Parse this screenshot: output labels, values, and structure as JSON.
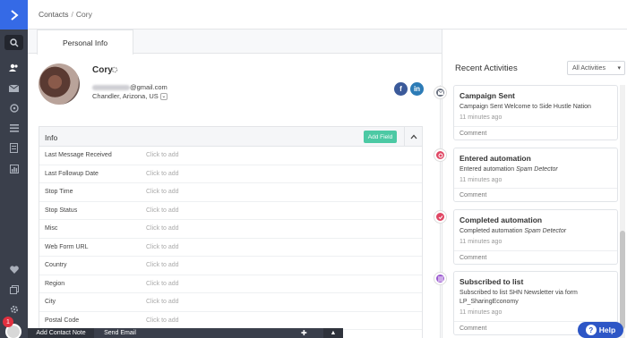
{
  "breadcrumb": {
    "root": "Contacts",
    "separator": "/",
    "current": "Cory"
  },
  "tabs": [
    {
      "label": "Personal Info"
    }
  ],
  "contact": {
    "name": "Cory",
    "email_suffix": "@gmail.com",
    "location": "Chandler, Arizona, US"
  },
  "info": {
    "title": "Info",
    "add_field_label": "Add Field",
    "placeholder": "Click to add",
    "fields": [
      {
        "label": "Last Message Received"
      },
      {
        "label": "Last Followup Date"
      },
      {
        "label": "Stop Time"
      },
      {
        "label": "Stop Status"
      },
      {
        "label": "Misc"
      },
      {
        "label": "Web Form URL"
      },
      {
        "label": "Country"
      },
      {
        "label": "Region"
      },
      {
        "label": "City"
      },
      {
        "label": "Postal Code"
      }
    ]
  },
  "bottom_bar": {
    "add_note": "Add Contact Note",
    "send_email": "Send Email"
  },
  "notifications": {
    "count": "1"
  },
  "recent": {
    "title": "Recent Activities",
    "filter": "All Activities",
    "comment_label": "Comment",
    "items": [
      {
        "title": "Campaign Sent",
        "desc": "Campaign Sent Welcome to Side Hustle Nation",
        "time": "11 minutes ago",
        "icon": "envelope-icon",
        "color": "#6b7280"
      },
      {
        "title": "Entered automation",
        "desc_prefix": "Entered automation",
        "desc_em": "Spam Detector",
        "time": "11 minutes ago",
        "icon": "automation-enter-icon",
        "color": "#e04764"
      },
      {
        "title": "Completed automation",
        "desc_prefix": "Completed automation",
        "desc_em": "Spam Detector",
        "time": "11 minutes ago",
        "icon": "automation-complete-icon",
        "color": "#e04764"
      },
      {
        "title": "Subscribed to list",
        "desc": "Subscribed to list SHN Newsletter via form",
        "desc2": "LP_SharingEconomy",
        "time": "11 minutes ago",
        "icon": "list-subscribe-icon",
        "color": "#9b59d0"
      }
    ]
  },
  "help": {
    "label": "Help"
  },
  "colors": {
    "rail": "#3a3f4b",
    "brand": "#356ae6",
    "add_field": "#4cc9a4",
    "help": "#2d56c6"
  }
}
